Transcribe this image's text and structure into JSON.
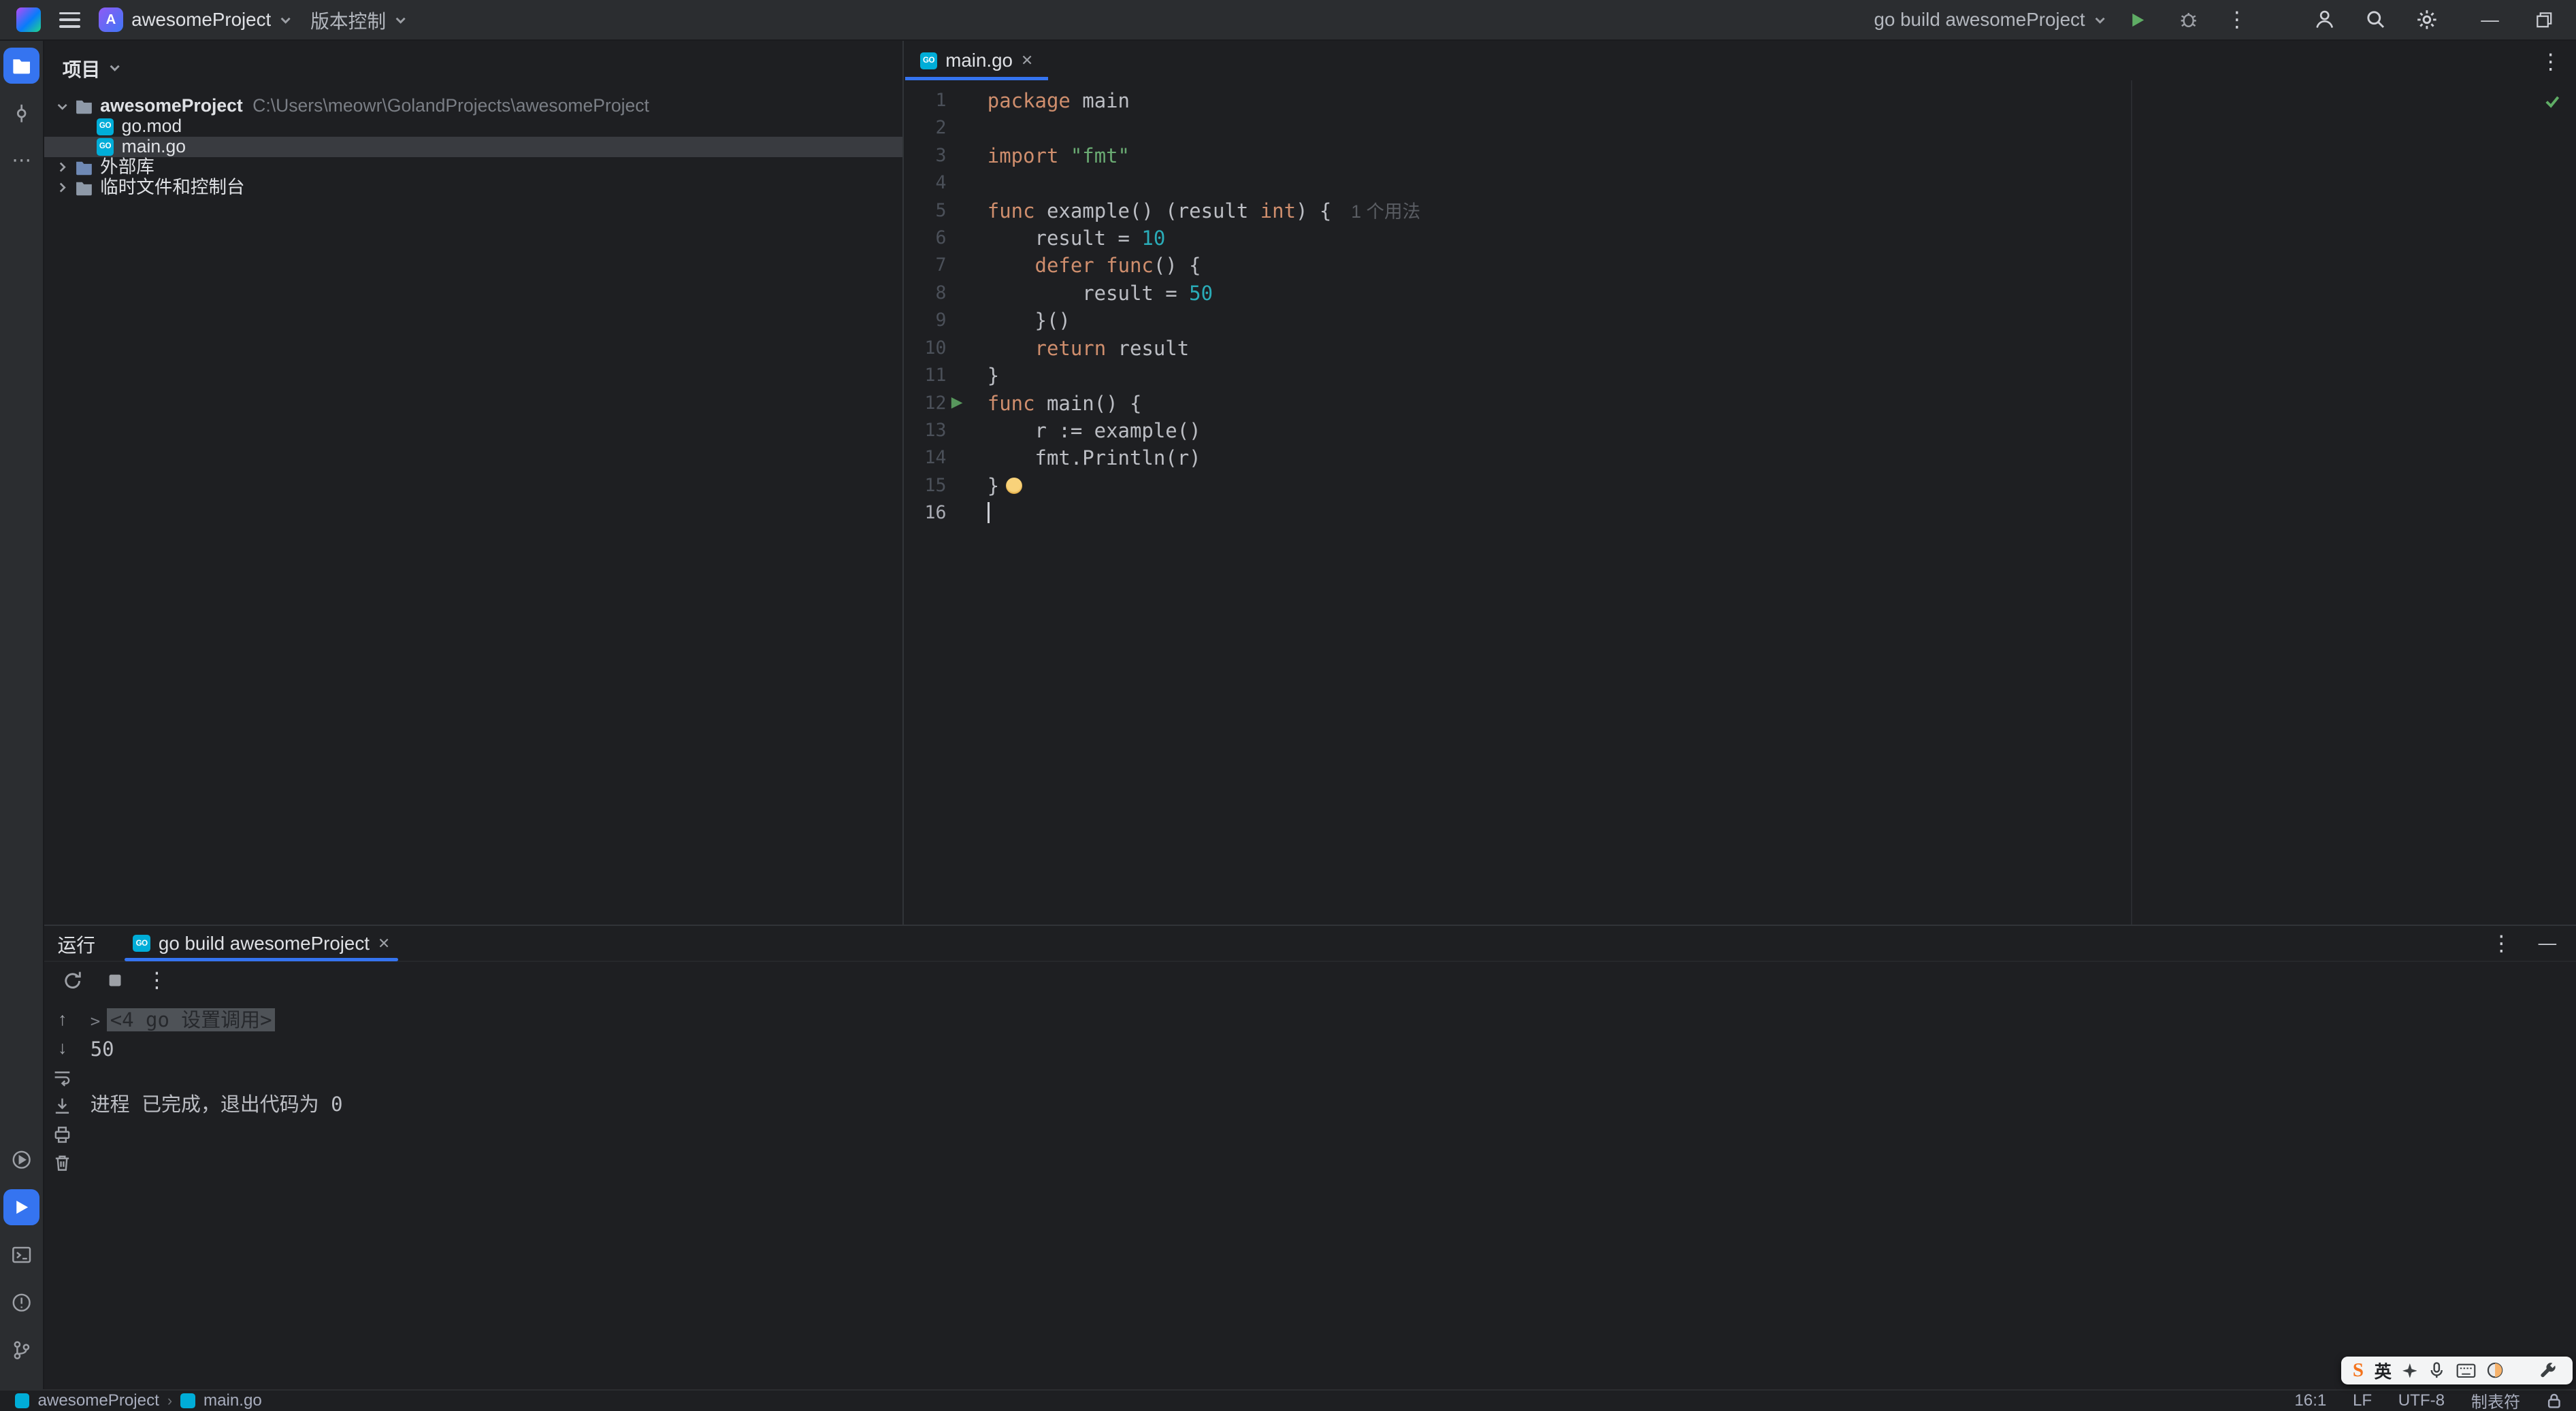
{
  "colors": {
    "accent": "#3574F0",
    "run_green": "#5FAD65",
    "keyword": "#CF8E6D",
    "string": "#6AAB73",
    "number": "#2AACB8",
    "selection_row": "#393B40"
  },
  "glyphs": {
    "more_v": "⋮",
    "more_h": "⋯",
    "close": "✕",
    "up": "↑",
    "down": "↓",
    "minimize": "—",
    "fold": ">",
    "run": "▶",
    "chevron_sep": "›"
  },
  "titlebar": {
    "project_initial": "A",
    "project_name": "awesomeProject",
    "vcs_label": "版本控制",
    "run_config": "go build awesomeProject"
  },
  "project": {
    "title": "项目",
    "root": "awesomeProject",
    "path": "C:\\Users\\meowr\\GolandProjects\\awesomeProject",
    "files": [
      "go.mod",
      "main.go"
    ],
    "nodes": [
      "外部库",
      "临时文件和控制台"
    ]
  },
  "editor": {
    "tab": "main.go",
    "lines": [
      {
        "n": 1,
        "t": [
          [
            "kw",
            "package"
          ],
          [
            "pl",
            " main"
          ]
        ]
      },
      {
        "n": 2,
        "t": []
      },
      {
        "n": 3,
        "t": [
          [
            "kw",
            "import"
          ],
          [
            "pl",
            " "
          ],
          [
            "st",
            "\"fmt\""
          ]
        ]
      },
      {
        "n": 4,
        "t": []
      },
      {
        "n": 5,
        "t": [
          [
            "kw",
            "func"
          ],
          [
            "pl",
            " example() (result "
          ],
          [
            "kw",
            "int"
          ],
          [
            "pl",
            ") {"
          ]
        ],
        "hint": "1 个用法"
      },
      {
        "n": 6,
        "t": [
          [
            "pl",
            "    result = "
          ],
          [
            "nu",
            "10"
          ]
        ]
      },
      {
        "n": 7,
        "t": [
          [
            "pl",
            "    "
          ],
          [
            "kw",
            "defer"
          ],
          [
            "pl",
            " "
          ],
          [
            "kw",
            "func"
          ],
          [
            "pl",
            "() {"
          ]
        ]
      },
      {
        "n": 8,
        "t": [
          [
            "pl",
            "        result = "
          ],
          [
            "nu",
            "50"
          ]
        ]
      },
      {
        "n": 9,
        "t": [
          [
            "pl",
            "    }()"
          ]
        ]
      },
      {
        "n": 10,
        "t": [
          [
            "pl",
            "    "
          ],
          [
            "kw",
            "return"
          ],
          [
            "pl",
            " result"
          ]
        ]
      },
      {
        "n": 11,
        "t": [
          [
            "pl",
            "}"
          ]
        ]
      },
      {
        "n": 12,
        "t": [
          [
            "kw",
            "func"
          ],
          [
            "pl",
            " main() {"
          ]
        ],
        "run": true
      },
      {
        "n": 13,
        "t": [
          [
            "pl",
            "    r := example()"
          ]
        ]
      },
      {
        "n": 14,
        "t": [
          [
            "pl",
            "    fmt.Println(r)"
          ]
        ]
      },
      {
        "n": 15,
        "t": [
          [
            "pl",
            "}"
          ]
        ],
        "bulb": true
      },
      {
        "n": 16,
        "t": [],
        "caret": true
      }
    ]
  },
  "run": {
    "label": "运行",
    "tab": "go build awesomeProject",
    "console": [
      {
        "folded": true,
        "text": "<4 go 设置调用>"
      },
      {
        "text": "50"
      },
      {
        "text": ""
      },
      {
        "text": "进程 已完成，退出代码为 0"
      }
    ]
  },
  "statusbar": {
    "crumb_project": "awesomeProject",
    "crumb_file": "main.go",
    "widgets": [
      {
        "name": "caret-position",
        "text": "16:1"
      },
      {
        "name": "line-separator",
        "text": "LF"
      },
      {
        "name": "encoding",
        "text": "UTF-8"
      },
      {
        "name": "indent",
        "text": "制表符"
      }
    ]
  },
  "ime": {
    "logo": "S",
    "lang": "英"
  }
}
